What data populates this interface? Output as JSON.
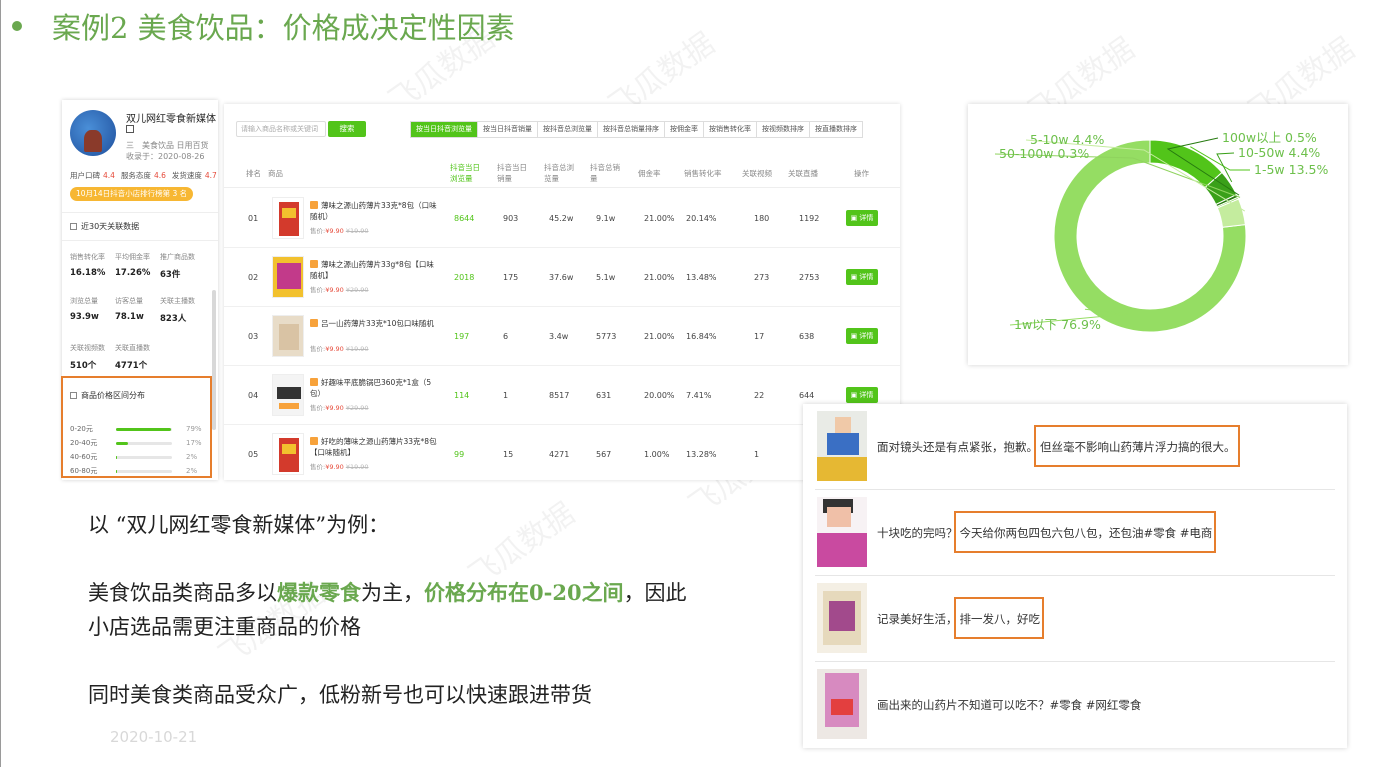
{
  "watermark": "飞瓜数据",
  "slide": {
    "title": "案例2 美食饮品：价格成决定性因素",
    "footer_date": "2020-10-21"
  },
  "shop": {
    "name": "双儿网红零食新媒体",
    "category": "三　美食饮品 日用百货",
    "joined": "收录于：2020-08-26",
    "scores": [
      {
        "label": "用户口碑",
        "value": "4.4"
      },
      {
        "label": "服务态度",
        "value": "4.6"
      },
      {
        "label": "发货速度",
        "value": "4.7"
      }
    ],
    "rank_badge": "10月14日抖音小店排行榜第 3 名",
    "recent_title": "近30天关联数据",
    "metrics": [
      {
        "label": "销售转化率",
        "value": "16.18%"
      },
      {
        "label": "平均佣金率",
        "value": "17.26%"
      },
      {
        "label": "推广商品数",
        "value": "63件"
      },
      {
        "label": "浏览总量",
        "value": "93.9w"
      },
      {
        "label": "访客总量",
        "value": "78.1w"
      },
      {
        "label": "关联主播数",
        "value": "823人"
      },
      {
        "label": "关联视频数",
        "value": "510个"
      },
      {
        "label": "关联直播数",
        "value": "4771个"
      }
    ],
    "price_title": "商品价格区间分布",
    "price_distribution": [
      {
        "range": "0-20元",
        "percent": 79,
        "label": "79%"
      },
      {
        "range": "20-40元",
        "percent": 17,
        "label": "17%"
      },
      {
        "range": "40-60元",
        "percent": 2,
        "label": "2%"
      },
      {
        "range": "60-80元",
        "percent": 2,
        "label": "2%"
      }
    ]
  },
  "products": {
    "search_placeholder": "请输入商品名称或关键词",
    "search_button": "搜索",
    "sort_tabs": [
      "按当日抖音浏览量",
      "按当日抖音销量",
      "按抖音总浏览量",
      "按抖音总销量排序",
      "按佣金率",
      "按销售转化率",
      "按视频数排序",
      "按直播数排序"
    ],
    "headers": {
      "rank": "排名",
      "product": "商品",
      "today_views": "抖音当日浏览量",
      "today_sales": "抖音当日销量",
      "total_views": "抖音总浏览量",
      "total_sales": "抖音总销量",
      "commission": "佣金率",
      "conversion": "销售转化率",
      "videos": "关联视频",
      "lives": "关联直播",
      "action": "操作"
    },
    "price_prefix": "售价:",
    "detail_label": "详情",
    "rows": [
      {
        "rank": "01",
        "name": "薄味之源山药薄片33克*8包（口味随机）",
        "price": "¥9.90",
        "orig": "¥19.90",
        "today_views": "8644",
        "today_sales": "903",
        "total_views": "45.2w",
        "total_sales": "9.1w",
        "commission": "21.00%",
        "conversion": "20.14%",
        "videos": "180",
        "lives": "1192"
      },
      {
        "rank": "02",
        "name": "薄味之源山药薄片33g*8包【口味随机】",
        "price": "¥9.90",
        "orig": "¥29.90",
        "today_views": "2018",
        "today_sales": "175",
        "total_views": "37.6w",
        "total_sales": "5.1w",
        "commission": "21.00%",
        "conversion": "13.48%",
        "videos": "273",
        "lives": "2753"
      },
      {
        "rank": "03",
        "name": "吕一山药薄片33克*10包口味随机",
        "price": "¥9.90",
        "orig": "¥19.90",
        "today_views": "197",
        "today_sales": "6",
        "total_views": "3.4w",
        "total_sales": "5773",
        "commission": "21.00%",
        "conversion": "16.84%",
        "videos": "17",
        "lives": "638"
      },
      {
        "rank": "04",
        "name": "好趣味平底脆锅巴360克*1盒（5包）",
        "price": "¥9.90",
        "orig": "¥29.90",
        "today_views": "114",
        "today_sales": "1",
        "total_views": "8517",
        "total_sales": "631",
        "commission": "20.00%",
        "conversion": "7.41%",
        "videos": "22",
        "lives": "644"
      },
      {
        "rank": "05",
        "name": "好吃的薄味之源山药薄片33克*8包【口味随机】",
        "price": "¥9.90",
        "orig": "¥19.90",
        "today_views": "99",
        "today_sales": "15",
        "total_views": "4271",
        "total_sales": "567",
        "commission": "1.00%",
        "conversion": "13.28%",
        "videos": "1",
        "lives": ""
      }
    ]
  },
  "chart_data": {
    "type": "pie",
    "style": "donut",
    "slices": [
      {
        "label": "1w以下",
        "value": 76.9,
        "text": "1w以下 76.9%",
        "color": "#95dd63"
      },
      {
        "label": "1-5w",
        "value": 13.5,
        "text": "1-5w 13.5%",
        "color": "#52c41a"
      },
      {
        "label": "10-50w",
        "value": 4.4,
        "text": "10-50w 4.4%",
        "color": "#3aa019"
      },
      {
        "label": "100w以上",
        "value": 0.5,
        "text": "100w以上 0.5%",
        "color": "#267a0f"
      },
      {
        "label": "50-100w",
        "value": 0.3,
        "text": "50-100w 0.3%",
        "color": "#8fd35e"
      },
      {
        "label": "5-10w",
        "value": 4.4,
        "text": "5-10w 4.4%",
        "color": "#c4ec9e"
      }
    ]
  },
  "comments": [
    {
      "plain": "面对镜头还是有点紧张，抱歉。",
      "highlight": "但丝毫不影响山药薄片浮力搞的很大。"
    },
    {
      "plain": "十块吃的完吗？",
      "highlight": "今天给你两包四包六包八包，还包油#零食 #电商"
    },
    {
      "plain": "记录美好生活，",
      "highlight": "排一发八，好吃"
    },
    {
      "plain": "画出来的山药片不知道可以吃不？#零食 #网红零食",
      "highlight": ""
    }
  ],
  "copy": {
    "line1": "以 “双儿网红零食新媒体”为例：",
    "line2_a": "美食饮品类商品多以",
    "line2_hl1": "爆款零食",
    "line2_b": "为主，",
    "line2_hl2": "价格分布在0-20之间",
    "line2_c": "，因此",
    "line3": "小店选品需更注重商品的价格",
    "line4": "同时美食类商品受众广，低粉新号也可以快速跟进带货"
  }
}
